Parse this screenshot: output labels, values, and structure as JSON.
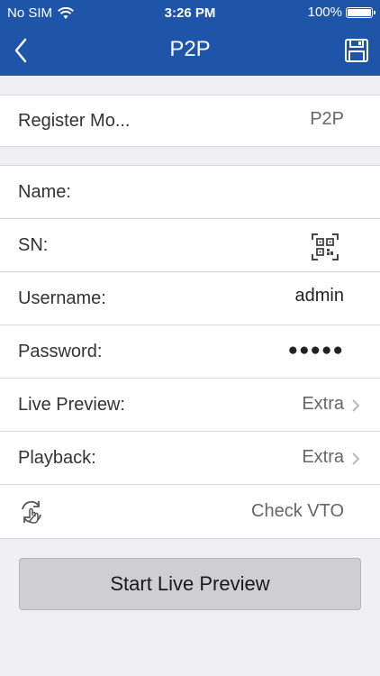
{
  "status_bar": {
    "carrier": "No SIM",
    "time": "3:26 PM",
    "battery": "100%"
  },
  "nav": {
    "title": "P2P"
  },
  "register_mode": {
    "label": "Register Mo...",
    "value": "P2P"
  },
  "form": {
    "name": {
      "label": "Name:",
      "value": ""
    },
    "sn": {
      "label": "SN:"
    },
    "username": {
      "label": "Username:",
      "value": "admin"
    },
    "password": {
      "label": "Password:",
      "value": "●●●●●"
    },
    "live_preview": {
      "label": "Live Preview:",
      "value": "Extra"
    },
    "playback": {
      "label": "Playback:",
      "value": "Extra"
    },
    "check_vto": {
      "label": "Check VTO"
    }
  },
  "start_button": {
    "label": "Start Live Preview"
  },
  "colors": {
    "nav_background": "#1f55a8",
    "page_background": "#efeff4",
    "button_background": "#cfcfd1"
  }
}
